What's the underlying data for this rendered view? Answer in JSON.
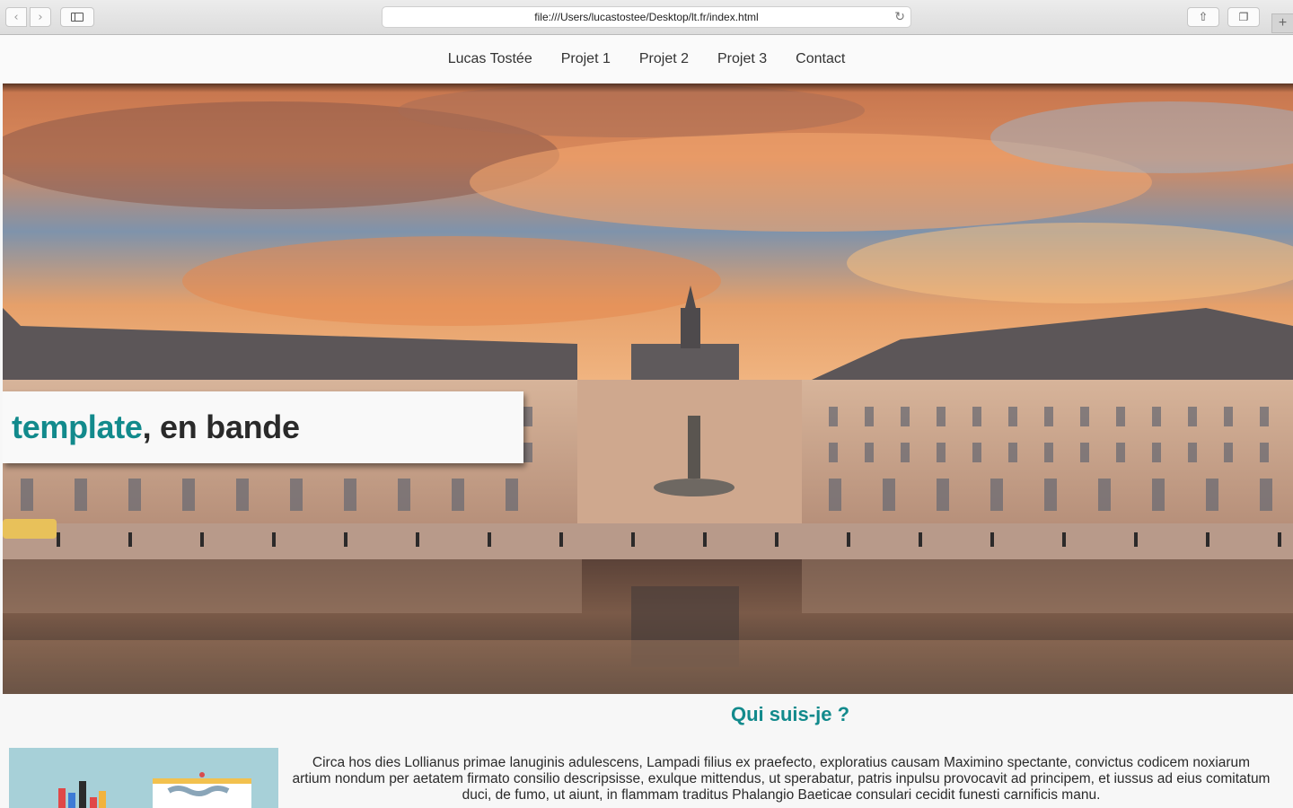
{
  "browser": {
    "url": "file:///Users/lucastostee/Desktop/lt.fr/index.html",
    "back_icon": "chevron-left-icon",
    "forward_icon": "chevron-right-icon",
    "sidebar_icon": "sidebar-icon",
    "reload_icon": "reload-icon",
    "share_icon": "share-icon",
    "tabs_icon": "tabs-icon",
    "new_tab_icon": "plus-icon"
  },
  "nav": {
    "items": [
      {
        "label": "Lucas Tostée"
      },
      {
        "label": "Projet 1"
      },
      {
        "label": "Projet 2"
      },
      {
        "label": "Projet 3"
      },
      {
        "label": "Contact"
      }
    ]
  },
  "hero": {
    "banner_accent": "template",
    "banner_rest": ", en bande",
    "accent_color": "#128a8c"
  },
  "about": {
    "title": "Qui suis-je ?",
    "paragraph": "Circa hos dies Lollianus primae lanuginis adulescens, Lampadi filius ex praefecto, exploratius causam Maximino spectante, convictus codicem noxiarum artium nondum per aetatem firmato consilio descripsisse, exulque mittendus, ut sperabatur, patris inpulsu provocavit ad principem, et iussus ad eius comitatum duci, de fumo, ut aiunt, in flammam traditus Phalangio Baeticae consulari cecidit funesti carnificis manu."
  }
}
